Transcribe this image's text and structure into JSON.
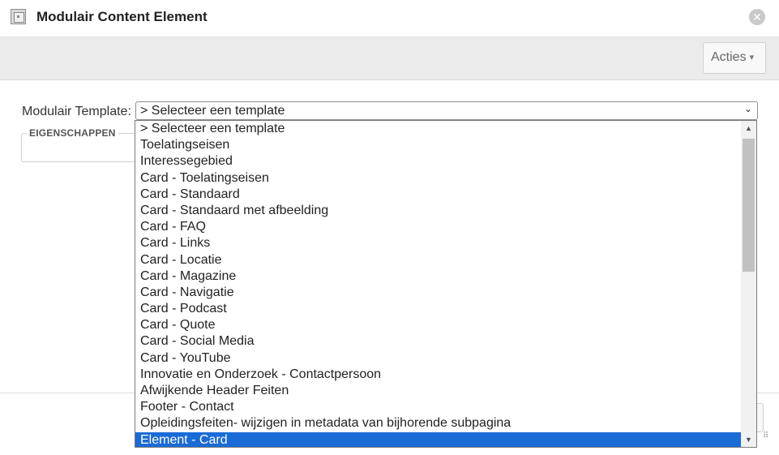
{
  "dialog": {
    "title": "Modulair Content Element",
    "close_glyph": "✕",
    "icon": "module-icon"
  },
  "toolbar": {
    "acties_label": "Acties",
    "acties_caret": "▾"
  },
  "form": {
    "template_label": "Modulair Template:",
    "template_selected": "> Selecteer een template",
    "select_arrow": "⌄",
    "fieldset_legend": "EIGENSCHAPPEN"
  },
  "dropdown": {
    "options": [
      "> Selecteer een template",
      "Toelatingseisen",
      "Interessegebied",
      "Card - Toelatingseisen",
      "Card - Standaard",
      "Card - Standaard met afbeelding",
      "Card - FAQ",
      "Card - Links",
      "Card - Locatie",
      "Card - Magazine",
      "Card - Navigatie",
      "Card - Podcast",
      "Card - Quote",
      "Card - Social Media",
      "Card - YouTube",
      "Innovatie en Onderzoek - Contactpersoon",
      "Afwijkende Header Feiten",
      "Footer - Contact",
      "Opleidingsfeiten- wijzigen in metadata van bijhorende subpagina",
      "Element - Card"
    ],
    "highlighted_option": "Element - Card",
    "scroll_up_glyph": "▲",
    "scroll_down_glyph": "▼"
  },
  "colors": {
    "highlight": "#1a6bd6",
    "toolbar_bg": "#ebebeb"
  }
}
